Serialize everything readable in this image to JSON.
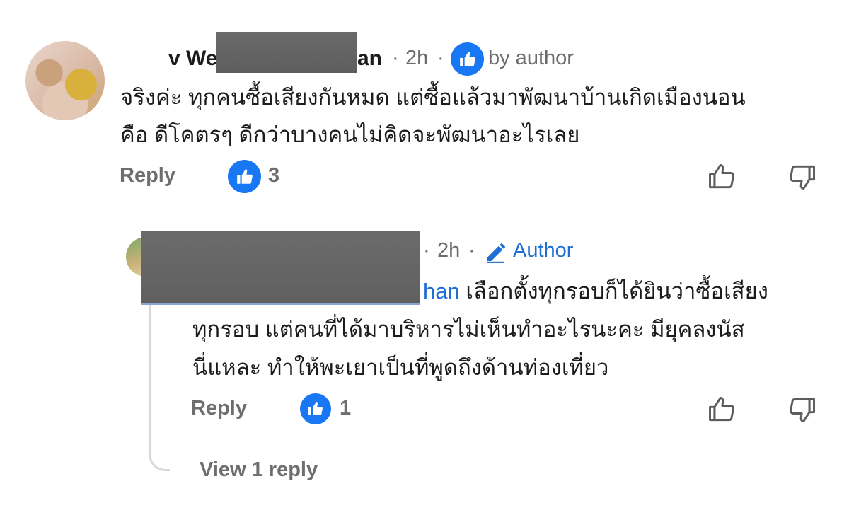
{
  "comments": [
    {
      "name_prefix": "v We",
      "name_suffix": "an",
      "time": "2h",
      "dot": "·",
      "author_label": "by author",
      "text_line1": "จริงค่ะ ทุกคนซื้อเสียงกันหมด แต่ซื้อแล้วมาพัฒนาบ้านเกิดเมืองนอน",
      "text_line2": "คือ ดีโคตรๆ ดีกว่าบางคนไม่คิดจะพัฒนาอะไรเลย",
      "reply_label": "Reply",
      "like_count": "3"
    }
  ],
  "reply": {
    "time": "2h",
    "dot": "·",
    "author_tag": "Author",
    "mention": "han",
    "text_line1": " เลือกตั้งทุกรอบก็ได้ยินว่าซื้อเสียง",
    "text_line2": "ทุกรอบ แต่คนที่ได้มาบริหารไม่เห็นทำอะไรนะคะ  มียุคลงนัส",
    "text_line3": "นี่แหละ ทำให้พะเยาเป็นที่พูดถึงด้านท่องเที่ยว",
    "reply_label": "Reply",
    "like_count": "1"
  },
  "view_replies_label": "View 1 reply",
  "colors": {
    "like_blue": "#1877f2",
    "author_blue": "#1f6ed4",
    "muted": "#6e6e6e",
    "redaction": "#656565"
  }
}
